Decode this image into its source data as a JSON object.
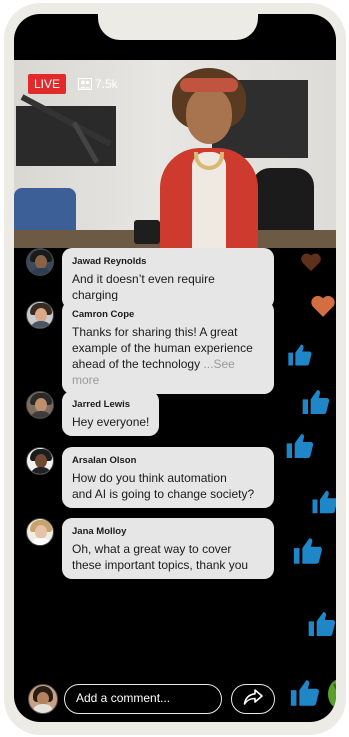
{
  "stream": {
    "live_label": "LIVE",
    "viewer_count": "7.5k",
    "viewer_icon": "viewers-icon"
  },
  "comments": [
    {
      "author": "Jawad Reynolds",
      "text": "And it doesn’t even require charging"
    },
    {
      "author": "Camron Cope",
      "text_lines": [
        "Thanks for sharing this! A great",
        "example of the human experience",
        "ahead of the technology "
      ],
      "see_more": "...See more"
    },
    {
      "author": "Jarred Lewis",
      "text": "Hey everyone!"
    },
    {
      "author": "Arsalan Olson",
      "text_lines": [
        "How do you think automation",
        "and AI is going to change society?"
      ]
    },
    {
      "author": "Jana Molloy",
      "text_lines": [
        "Oh, what a great way to cover",
        "these important topics, thank you"
      ]
    }
  ],
  "composer": {
    "placeholder": "Add a comment...",
    "share_icon": "share-icon"
  },
  "reactions": {
    "types": [
      "heart",
      "like",
      "clap"
    ],
    "colors": {
      "heart": "#d36d42",
      "like": "#1f86c8",
      "clap": "#5aa02c"
    }
  },
  "colors": {
    "live_badge": "#e22a2a",
    "bubble_bg": "#e6e6e6",
    "screen_bg": "#000000",
    "bezel": "#ecebe6"
  }
}
